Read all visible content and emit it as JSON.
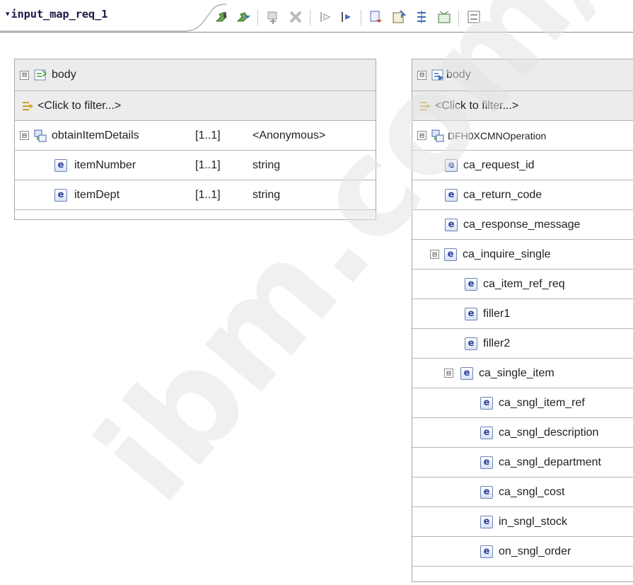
{
  "editor": {
    "tab_title": "input_map_req_1",
    "tab_collapse_glyph": "▾",
    "toolbar_icons": [
      "add-mapping-icon",
      "add-submap-icon",
      "add-input-icon",
      "delete-icon",
      "move-left-icon",
      "move-right-icon",
      "auto-map-icon",
      "export-icon",
      "sort-icon",
      "xslt-icon",
      "outline-icon"
    ]
  },
  "source_panel": {
    "header": {
      "label": "body",
      "twisty": "⊟"
    },
    "filter": {
      "label": "<Click to filter...>"
    },
    "rows": [
      {
        "name": "obtainItemDetails",
        "multiplicity": "[1..1]",
        "type": "<Anonymous>",
        "kind": "complex",
        "expanded": true,
        "level": 0
      },
      {
        "name": "itemNumber",
        "multiplicity": "[1..1]",
        "type": "string",
        "kind": "element",
        "level": 1
      },
      {
        "name": "itemDept",
        "multiplicity": "[1..1]",
        "type": "string",
        "kind": "element",
        "level": 1
      }
    ]
  },
  "target_panel": {
    "header": {
      "label": "body",
      "twisty": "⊟"
    },
    "filter": {
      "label": "<Click to filter...>"
    },
    "rows": [
      {
        "name": "DFH0XCMNOperation",
        "kind": "complex",
        "expanded": true,
        "level": 0
      },
      {
        "name": "ca_request_id",
        "kind": "element",
        "level": 1
      },
      {
        "name": "ca_return_code",
        "kind": "element",
        "level": 1
      },
      {
        "name": "ca_response_message",
        "kind": "element",
        "level": 1
      },
      {
        "name": "ca_inquire_single",
        "kind": "element",
        "expanded": true,
        "level": 1
      },
      {
        "name": "ca_item_ref_req",
        "kind": "element",
        "level": 2
      },
      {
        "name": "filler1",
        "kind": "element",
        "level": 2
      },
      {
        "name": "filler2",
        "kind": "element",
        "level": 2
      },
      {
        "name": "ca_single_item",
        "kind": "element",
        "expanded": true,
        "level": 2
      },
      {
        "name": "ca_sngl_item_ref",
        "kind": "element",
        "level": 3
      },
      {
        "name": "ca_sngl_description",
        "kind": "element",
        "level": 3
      },
      {
        "name": "ca_sngl_department",
        "kind": "element",
        "level": 3
      },
      {
        "name": "ca_sngl_cost",
        "kind": "element",
        "level": 3
      },
      {
        "name": "in_sngl_stock",
        "kind": "element",
        "level": 3
      },
      {
        "name": "on_sngl_order",
        "kind": "element",
        "level": 3
      }
    ]
  },
  "colors": {
    "element_icon": "#2b3f9a",
    "panel_border": "#a7a7a7",
    "header_bg": "#ececec",
    "watermark": "#e6e6e6"
  },
  "watermark_text": "ibm.com/redbooks"
}
